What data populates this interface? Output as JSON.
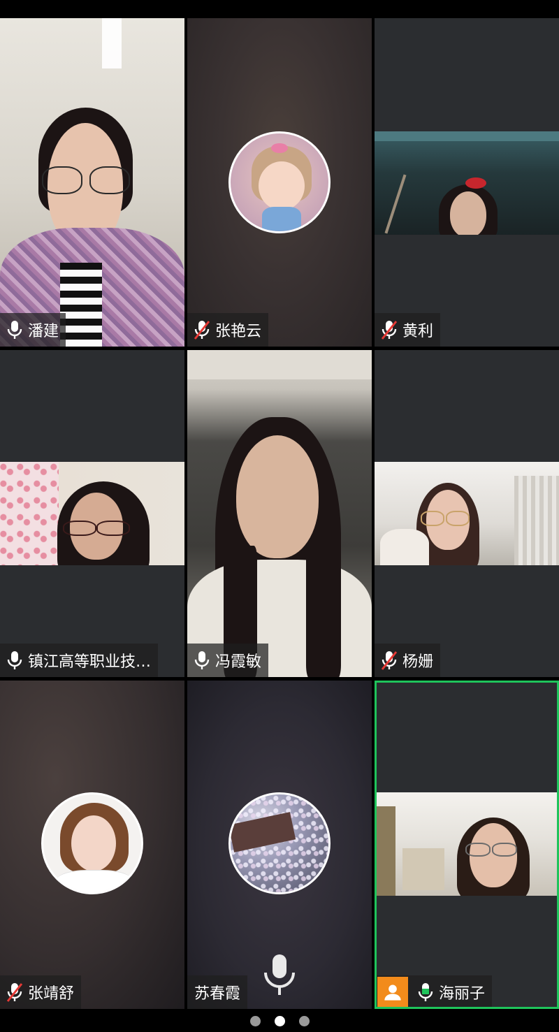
{
  "participants": [
    {
      "name": "潘建",
      "mic": "on"
    },
    {
      "name": "张艳云",
      "mic": "muted"
    },
    {
      "name": "黄利",
      "mic": "muted"
    },
    {
      "name": "镇江高等职业技…",
      "mic": "on"
    },
    {
      "name": "冯霞敏",
      "mic": "on"
    },
    {
      "name": "杨姗",
      "mic": "muted"
    },
    {
      "name": "张靖舒",
      "mic": "muted"
    },
    {
      "name": "苏春霞",
      "mic": "none"
    },
    {
      "name": "海丽子",
      "mic": "on-active",
      "active_speaker": true
    }
  ],
  "pagination": {
    "total_pages": 3,
    "current_page": 2
  },
  "colors": {
    "active_border": "#1fc45b",
    "user_badge": "#f28b1b",
    "muted_red": "#e53935"
  },
  "icons": {
    "mic": "microphone-icon",
    "muted": "microphone-muted-icon",
    "user": "user-icon"
  }
}
